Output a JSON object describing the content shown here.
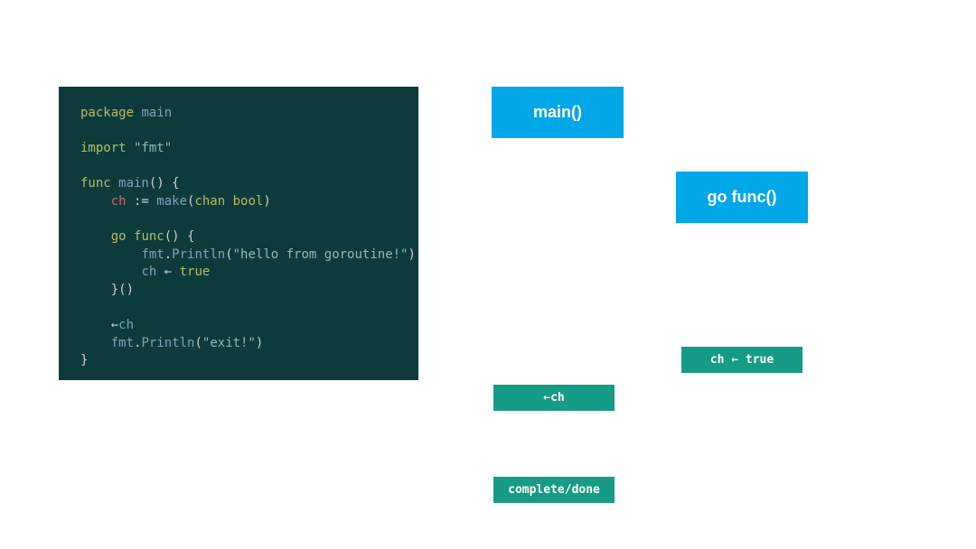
{
  "code": {
    "line1_kw": "package",
    "line1_name": " main",
    "empty": "",
    "line3_kw": "import",
    "line3_str": " \"fmt\"",
    "line5_func": "func",
    "line5_main": " main",
    "line5_paren": "()",
    "line5_brace": " {",
    "line6_indent": "    ",
    "line6_ch": "ch",
    "line6_assign": " := ",
    "line6_make": "make",
    "line6_paren_open": "(",
    "line6_chan": "chan",
    "line6_space": " ",
    "line6_bool": "bool",
    "line6_paren_close": ")",
    "line8_indent": "    ",
    "line8_go": "go",
    "line8_space": " ",
    "line8_func": "func",
    "line8_paren": "()",
    "line8_brace": " {",
    "line9_indent": "        ",
    "line9_fmt": "fmt",
    "line9_dot": ".",
    "line9_println": "Println",
    "line9_paren_open": "(",
    "line9_str": "\"hello from goroutine!\"",
    "line9_paren_close": ")",
    "line10_indent": "        ",
    "line10_ch": "ch",
    "line10_arrow": " ← ",
    "line10_true": "true",
    "line11_indent": "    ",
    "line11_close": "}()",
    "line13_indent": "    ",
    "line13_arrow": "←",
    "line13_ch": "ch",
    "line14_indent": "    ",
    "line14_fmt": "fmt",
    "line14_dot": ".",
    "line14_println": "Println",
    "line14_paren_open": "(",
    "line14_str": "\"exit!\"",
    "line14_paren_close": ")",
    "line15_brace": "}"
  },
  "diagram": {
    "main_label": "main()",
    "gofunc_label": "go func()",
    "chtrue_label": "ch ← true",
    "chrecv_label": "←ch",
    "done_label": "complete/done"
  }
}
